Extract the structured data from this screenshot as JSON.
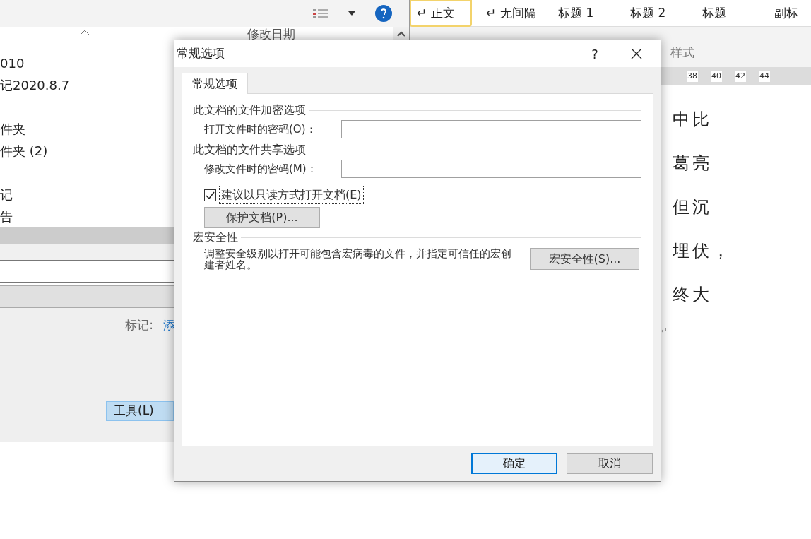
{
  "explorer": {
    "column_header": "修改日期",
    "items": [
      "010",
      "记2020.8.7",
      "件夹",
      "件夹 (2)",
      "记",
      "告"
    ],
    "tags_label": "标记:",
    "tags_link": "添",
    "tools_button": "工具(L)"
  },
  "word": {
    "styles": [
      {
        "label": "↵ 正文",
        "selected": true
      },
      {
        "label": "↵ 无间隔",
        "selected": false
      },
      {
        "label": "标题 1",
        "selected": false
      },
      {
        "label": "标题 2",
        "selected": false
      },
      {
        "label": "标题",
        "selected": false
      },
      {
        "label": "副标",
        "selected": false
      }
    ],
    "group_label": "样式",
    "ruler": [
      "38",
      "40",
      "42",
      "44"
    ],
    "lines": [
      "中比",
      "葛亮",
      "但沉",
      "埋伏，",
      "终大"
    ],
    "end_mark": "↵"
  },
  "dialog": {
    "title": "常规选项",
    "help": "?",
    "tabs": [
      {
        "label": "常规选项",
        "selected": true
      }
    ],
    "sections": [
      {
        "heading": "此文档的文件加密选项",
        "rows": [
          {
            "kind": "field",
            "label": "打开文件时的密码(O)："
          }
        ]
      },
      {
        "heading": "此文档的文件共享选项",
        "rows": [
          {
            "kind": "field",
            "label": "修改文件时的密码(M)："
          },
          {
            "kind": "checkbox",
            "label": "建议以只读方式打开文档(E)",
            "checked": true
          },
          {
            "kind": "button",
            "label": "保护文档(P)..."
          }
        ]
      },
      {
        "heading": "宏安全性",
        "rows": [
          {
            "kind": "text_button",
            "label": "调整安全级别以打开可能包含宏病毒的文件，并指定可信任的宏创建者姓名。",
            "button": "宏安全性(S)..."
          }
        ]
      }
    ],
    "buttons": [
      {
        "label": "确定",
        "selected": true
      },
      {
        "label": "取消",
        "selected": false
      }
    ]
  }
}
